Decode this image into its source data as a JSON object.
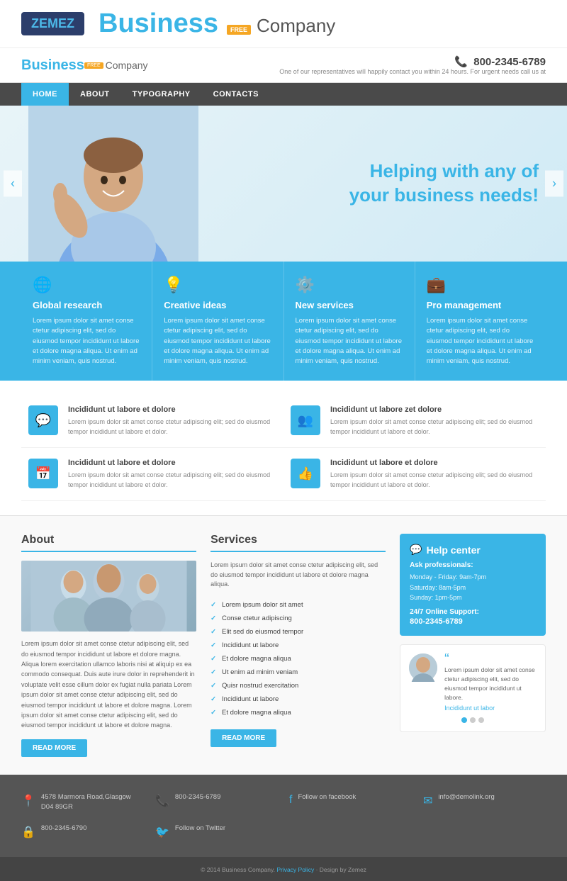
{
  "topBar": {
    "zemez": "ZE",
    "zemez2": "MEZ",
    "brand": "Business",
    "freeBadge": "FREE",
    "company": "Company"
  },
  "header": {
    "logoText": "Business",
    "freeBadge": "FREE",
    "companyText": "Company",
    "phone": "800-2345-6789",
    "tagline": "One of our representatives will happily contact you within 24 hours. For urgent needs call us at"
  },
  "nav": {
    "items": [
      "HOME",
      "ABOUT",
      "TYPOGRAPHY",
      "CONTACTS"
    ]
  },
  "hero": {
    "headline": "Helping with any of\nyour business needs!"
  },
  "features": [
    {
      "icon": "🌐",
      "title": "Global research",
      "text": "Lorem ipsum dolor sit amet conse ctetur adipiscing elit, sed do eiusmod tempor incididunt ut labore et dolore magna aliqua. Ut enim ad minim veniam, quis nostrud."
    },
    {
      "icon": "💡",
      "title": "Creative ideas",
      "text": "Lorem ipsum dolor sit amet conse ctetur adipiscing elit, sed do eiusmod tempor incididunt ut labore et dolore magna aliqua. Ut enim ad minim veniam, quis nostrud."
    },
    {
      "icon": "⚙️",
      "title": "New services",
      "text": "Lorem ipsum dolor sit amet conse ctetur adipiscing elit, sed do eiusmod tempor incididunt ut labore et dolore magna aliqua. Ut enim ad minim veniam, quis nostrud."
    },
    {
      "icon": "💼",
      "title": "Pro management",
      "text": "Lorem ipsum dolor sit amet conse ctetur adipiscing elit, sed do eiusmod tempor incididunt ut labore et dolore magna aliqua. Ut enim ad minim veniam, quis nostrud."
    }
  ],
  "serviceIcons": [
    {
      "icon": "💬",
      "title": "Incididunt ut labore et dolore",
      "text": "Lorem ipsum dolor sit amet conse ctetur adipiscing elit; sed do eiusmod tempor incididunt ut labore et dolor."
    },
    {
      "icon": "👥",
      "title": "Incididunt ut labore zet dolore",
      "text": "Lorem ipsum dolor sit amet conse ctetur adipiscing elit; sed do eiusmod tempor incididunt ut labore et dolor."
    },
    {
      "icon": "📅",
      "title": "Incididunt ut labore et dolore",
      "text": "Lorem ipsum dolor sit amet conse ctetur adipiscing elit; sed do eiusmod tempor incididunt ut labore et dolor."
    },
    {
      "icon": "👍",
      "title": "Incididunt ut labore et dolore",
      "text": "Lorem ipsum dolor sit amet conse ctetur adipiscing elit; sed do eiusmod tempor incididunt ut labore et dolor."
    }
  ],
  "about": {
    "title": "About",
    "text1": "Lorem ipsum dolor sit amet conse ctetur adipiscing elit, sed do eiusmod tempor incididunt ut labore et dolore magna. Aliqua lorem exercitation ullamco laboris nisi at aliquip ex ea commodo consequat. Duis aute irure dolor in reprehenderit in voluptate velit esse cillum dolor ex fugiat nulla pariata Lorem ipsum dolor sit amet conse ctetur adipiscing elit, sed do eiusmod tempor incididunt ut labore et dolore magna. Lorem ipsum dolor sit amet conse ctetur adipiscing elit, sed do eiusmod tempor incididunt ut labore et dolore magna.",
    "readMore": "READ MORE"
  },
  "services": {
    "title": "Services",
    "intro": "Lorem ipsum dolor sit amet conse ctetur adipiscing elit, sed do eiusmod tempor incididunt ut labore et dolore magna aliqua.",
    "items": [
      "Lorem ipsum dolor sit amet",
      "Conse ctetur adipiscing",
      "Elit sed do eiusmod tempor",
      "Incididunt ut labore",
      "Et dolore magna aliqua",
      "Ut enim ad minim veniam",
      "Quisr nostrud exercitation",
      "Incididunt ut labore",
      "Et dolore magna aliqua"
    ],
    "readMore": "READ MORE"
  },
  "helpCenter": {
    "title": "Help center",
    "askProfessionals": "Ask professionals:",
    "hours": "Monday - Friday: 9am-7pm\nSaturday: 8am-5pm\nSunday: 1pm-5pm",
    "support247": "24/7 Online Support:",
    "phone": "800-2345-6789"
  },
  "testimonial": {
    "text": "Lorem ipsum dolor sit amet conse ctetur adipiscing elit, sed do eiusmod tempor incididunt ut labore.",
    "link": "Incididunt ut labor"
  },
  "footer": {
    "address": "4578 Marmora Road,Glasgow D04 89GR",
    "phone1": "800-2345-6789",
    "facebook": "Follow on facebook",
    "email": "info@demolink.org",
    "phone2": "800-2345-6790",
    "twitter": "Follow on Twitter",
    "copyright": "© 2014 Business Company.",
    "privacy": "Privacy Policy",
    "design": "Design by Zemez"
  }
}
